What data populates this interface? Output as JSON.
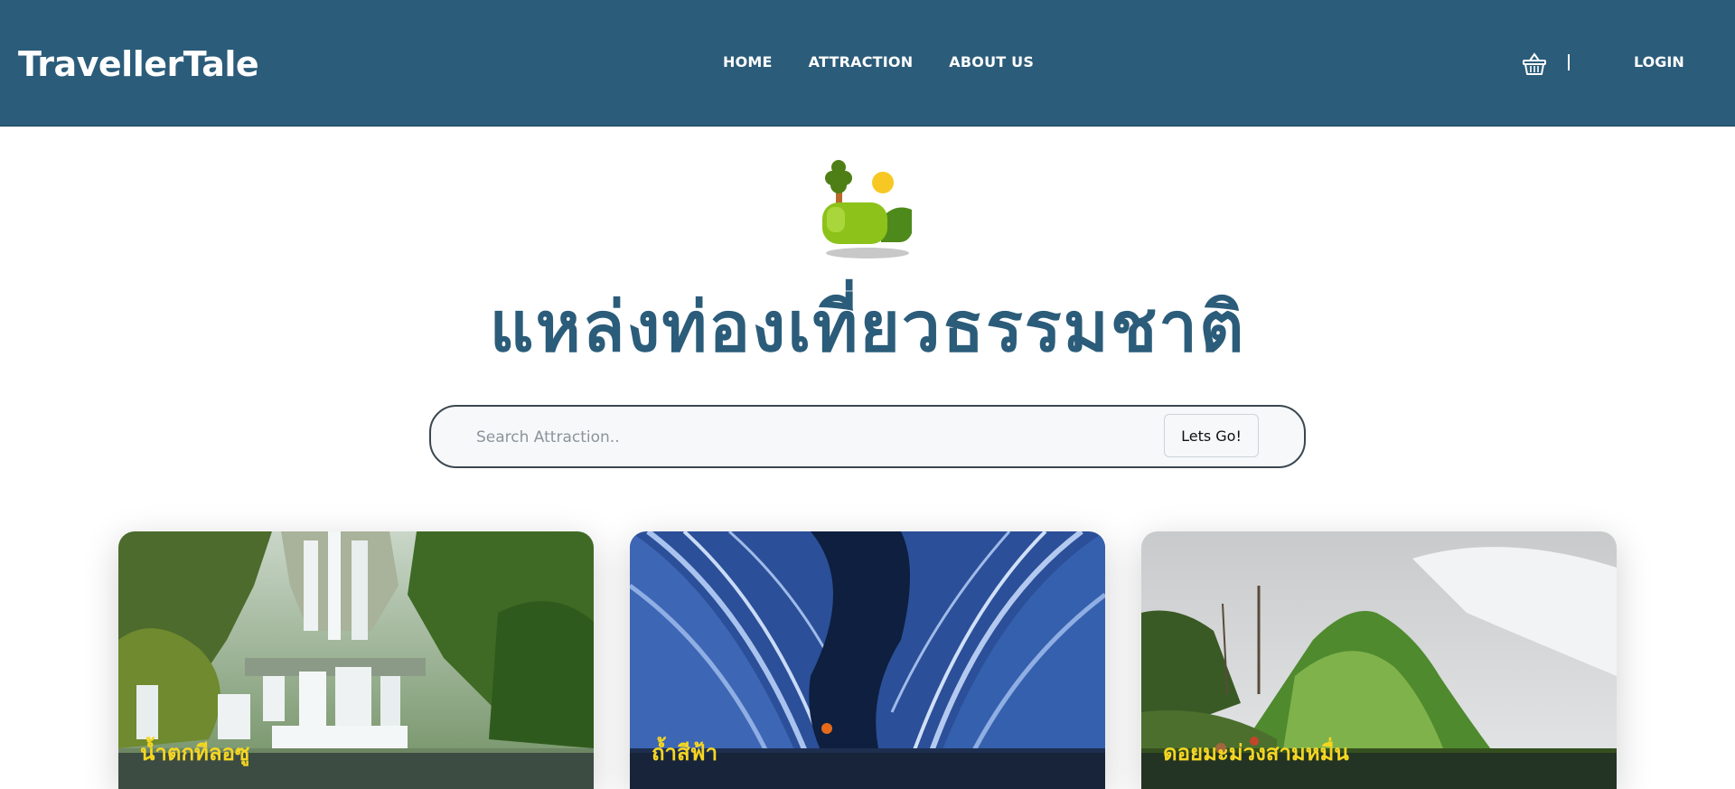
{
  "header": {
    "brand": "TravellerTale",
    "nav": [
      {
        "label": "HOME"
      },
      {
        "label": "ATTRACTION"
      },
      {
        "label": "ABOUT US"
      }
    ],
    "cart_icon": "basket-icon",
    "login_label": "LOGIN",
    "background_color": "#2b5c7a"
  },
  "hero": {
    "icon": "nature-landscape-icon",
    "title": "แหล่งท่องเที่ยวธรรมชาติ",
    "title_color": "#2b5c7a"
  },
  "search": {
    "placeholder": "Search Attraction..",
    "value": "",
    "button_label": "Lets Go!"
  },
  "cards": [
    {
      "title": "น้ำตกทีลอซู",
      "image": "waterfall-photo"
    },
    {
      "title": "ถ้ำสีฟ้า",
      "image": "blue-cave-photo"
    },
    {
      "title": "ดอยมะม่วงสามหมื่น",
      "image": "green-mountain-photo"
    }
  ],
  "caption_color": "#f5d622"
}
